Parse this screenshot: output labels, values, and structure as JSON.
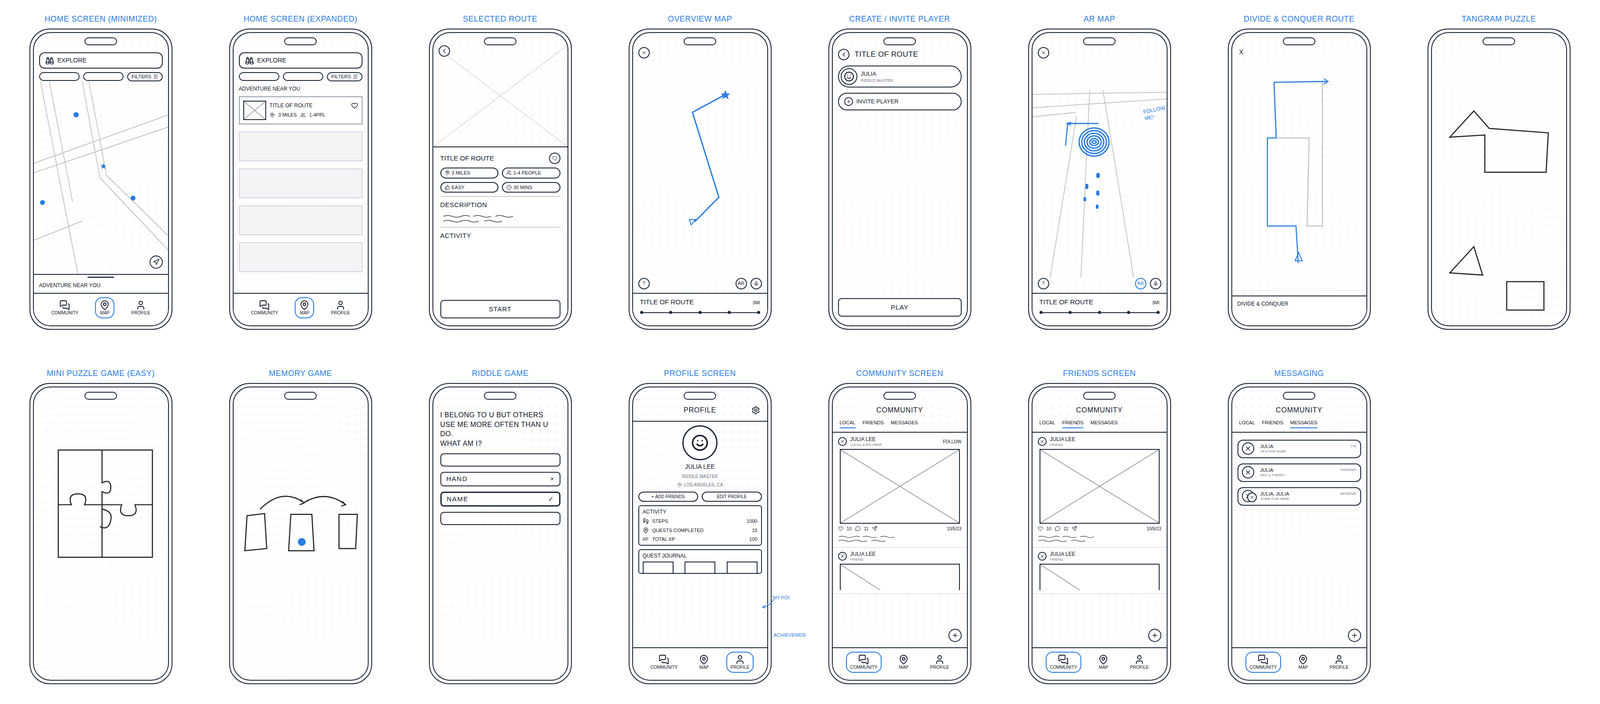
{
  "screens": {
    "home_minimized": {
      "title": "HOME SCREEN (MINIMIZED)",
      "search": "EXPLORE",
      "filters": "FILTERS",
      "sheet_label": "ADVENTURE NEAR YOU",
      "nav": [
        {
          "label": "COMMUNITY",
          "selected": false
        },
        {
          "label": "MAP",
          "selected": true
        },
        {
          "label": "PROFILE",
          "selected": false
        }
      ]
    },
    "home_expanded": {
      "title": "HOME SCREEN (EXPANDED)",
      "search": "EXPLORE",
      "filters": "FILTERS",
      "heading": "ADVENTURE NEAR YOU",
      "card": {
        "title": "TITLE OF ROUTE",
        "distance": "3 MILES",
        "people": "1-4PPL"
      },
      "nav": [
        {
          "label": "COMMUNITY",
          "selected": false
        },
        {
          "label": "MAP",
          "selected": true
        },
        {
          "label": "PROFILE",
          "selected": false
        }
      ]
    },
    "selected_route": {
      "title": "SELECTED ROUTE",
      "route_title": "TITLE OF ROUTE",
      "tags": [
        "3 MILES",
        "1-4 PEOPLE",
        "EASY",
        "30 MINS"
      ],
      "description_label": "DESCRIPTION",
      "activity_label": "ACTIVITY",
      "button": "START"
    },
    "overview_map": {
      "title": "OVERVIEW MAP",
      "help": "?",
      "ar": "AR",
      "ar_selected": false,
      "route_title": "TITLE OF ROUTE",
      "distance": "3MI"
    },
    "create_invite": {
      "title": "CREATE / INVITE PLAYER",
      "route_title": "TITLE OF ROUTE",
      "players": [
        {
          "name": "JULIA",
          "role": "RIDDLE MASTER"
        }
      ],
      "invite": "INVITE PLAYER",
      "button": "PLAY"
    },
    "ar_map": {
      "title": "AR MAP",
      "callout": "FOLLOW ME!",
      "help": "?",
      "ar": "AR",
      "ar_selected": true,
      "route_title": "TITLE OF ROUTE",
      "distance": "3MI"
    },
    "divide_conquer": {
      "title": "DIVIDE & CONQUER ROUTE",
      "close": "X",
      "label": "DIVIDE & CONQUER"
    },
    "tangram": {
      "title": "TANGRAM PUZZLE"
    },
    "mini_puzzle": {
      "title": "MINI PUZZLE GAME (EASY)"
    },
    "memory": {
      "title": "MEMORY GAME"
    },
    "riddle": {
      "title": "RIDDLE GAME",
      "question": "I BELONG TO U BUT OTHERS USE ME MORE OFTEN THAN U DO.",
      "prompt": "WHAT AM I?",
      "answers": [
        {
          "text": "",
          "result": "none",
          "mark": ""
        },
        {
          "text": "HAND",
          "result": "wrong",
          "mark": "×"
        },
        {
          "text": "NAME",
          "result": "correct",
          "mark": "✓"
        },
        {
          "text": "",
          "result": "none",
          "mark": ""
        }
      ]
    },
    "profile": {
      "title": "PROFILE SCREEN",
      "header": "PROFILE",
      "name": "JULIA LEE",
      "role": "RIDDLE MASTER",
      "location": "LOS ANGELES, CA",
      "add_friends": "+ ADD FRIENDS",
      "edit_profile": "EDIT PROFILE",
      "activity_label": "ACTIVITY",
      "stats": [
        {
          "label": "STEPS",
          "value": "1000",
          "glyph": ""
        },
        {
          "label": "QUESTS COMPLETED",
          "value": "10",
          "glyph": ""
        },
        {
          "label": "TOTAL XP",
          "value": "100",
          "glyph": "XP"
        }
      ],
      "journal_label": "QUEST JOURNAL",
      "annotations": [
        "MY POI",
        "ACHIEVEMEN"
      ],
      "nav": [
        {
          "label": "COMMUNITY",
          "selected": false
        },
        {
          "label": "MAP",
          "selected": false
        },
        {
          "label": "PROFILE",
          "selected": true
        }
      ]
    },
    "community": {
      "title": "COMMUNITY SCREEN",
      "header": "COMMUNITY",
      "tabs": [
        {
          "label": "LOCAL",
          "selected": true
        },
        {
          "label": "FRIENDS",
          "selected": false
        },
        {
          "label": "MESSAGES",
          "selected": false
        }
      ],
      "posts": [
        {
          "name": "JULIA LEE",
          "subtitle": "LOCAL EXPLORER",
          "follow": "FOLLOW",
          "likes": "10",
          "comments": "11",
          "date": "10/5/23",
          "kind": "full"
        },
        {
          "name": "JULIA LEE",
          "subtitle": "FRIEND",
          "follow": "",
          "likes": "",
          "comments": "",
          "date": "",
          "kind": "partial"
        }
      ],
      "nav": [
        {
          "label": "COMMUNITY",
          "selected": true
        },
        {
          "label": "MAP",
          "selected": false
        },
        {
          "label": "PROFILE",
          "selected": false
        }
      ]
    },
    "friends": {
      "title": "FRIENDS SCREEN",
      "header": "COMMUNITY",
      "tabs": [
        {
          "label": "LOCAL",
          "selected": false
        },
        {
          "label": "FRIENDS",
          "selected": true
        },
        {
          "label": "MESSAGES",
          "selected": false
        }
      ],
      "posts": [
        {
          "name": "JULIA LEE",
          "subtitle": "FRIEND",
          "follow": "",
          "likes": "10",
          "comments": "11",
          "date": "10/5/23",
          "kind": "full"
        },
        {
          "name": "JULIA LEE",
          "subtitle": "FRIEND",
          "follow": "",
          "likes": "",
          "comments": "",
          "date": "",
          "kind": "partial"
        }
      ],
      "nav": [
        {
          "label": "COMMUNITY",
          "selected": true
        },
        {
          "label": "MAP",
          "selected": false
        },
        {
          "label": "PROFILE",
          "selected": false
        }
      ]
    },
    "messaging": {
      "title": "MESSAGING",
      "header": "COMMUNITY",
      "tabs": [
        {
          "label": "LOCAL",
          "selected": false
        },
        {
          "label": "FRIENDS",
          "selected": false
        },
        {
          "label": "MESSAGES",
          "selected": true
        }
      ],
      "messages": [
        {
          "name": "JULIA",
          "preview": "YES FOR SURE",
          "time": "2:00",
          "group": false
        },
        {
          "name": "JULIA",
          "preview": "SEE U THERE?",
          "time": "THURSDAY",
          "group": false
        },
        {
          "name": "JULIA, JULIA",
          "preview": "SOME FUN HERE",
          "time": "SATURDAY",
          "group": true
        }
      ],
      "nav": [
        {
          "label": "COMMUNITY",
          "selected": true
        },
        {
          "label": "MAP",
          "selected": false
        },
        {
          "label": "PROFILE",
          "selected": false
        }
      ]
    }
  }
}
